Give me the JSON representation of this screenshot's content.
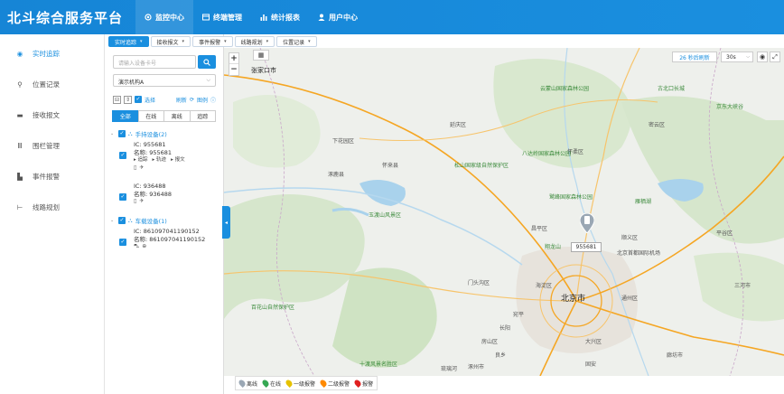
{
  "header": {
    "brand": "北斗综合服务平台",
    "nav": [
      {
        "label": "监控中心",
        "icon": "monitor-icon",
        "active": true
      },
      {
        "label": "终端管理",
        "icon": "terminal-icon",
        "active": false
      },
      {
        "label": "统计报表",
        "icon": "chart-icon",
        "active": false
      },
      {
        "label": "用户中心",
        "icon": "user-icon",
        "active": false
      }
    ]
  },
  "sidebar": {
    "items": [
      {
        "label": "实时追踪",
        "icon": "target-icon",
        "active": true
      },
      {
        "label": "位置记录",
        "icon": "location-icon",
        "active": false
      },
      {
        "label": "接收报文",
        "icon": "message-icon",
        "active": false
      },
      {
        "label": "围栏管理",
        "icon": "fence-icon",
        "active": false
      },
      {
        "label": "事件报警",
        "icon": "alarm-icon",
        "active": false
      },
      {
        "label": "线路规划",
        "icon": "route-icon",
        "active": false
      }
    ]
  },
  "tabs": [
    {
      "label": "实时追踪",
      "active": true
    },
    {
      "label": "接收报文",
      "active": false
    },
    {
      "label": "事件报警",
      "active": false
    },
    {
      "label": "线路规划",
      "active": false
    },
    {
      "label": "位置记录",
      "active": false
    }
  ],
  "panel": {
    "search_placeholder": "请输入设备卡号",
    "org_select": "演示机构A",
    "select_all_label": "选择",
    "refresh_label": "刷新",
    "legend_label": "图例",
    "filters": [
      {
        "label": "全部",
        "active": true
      },
      {
        "label": "在线",
        "active": false
      },
      {
        "label": "离线",
        "active": false
      },
      {
        "label": "追踪",
        "active": false
      }
    ],
    "groups": [
      {
        "name": "手持设备(2)",
        "devices": [
          {
            "ic": "IC: 955681",
            "name": "名称: 955681",
            "links": [
              "追踪",
              "轨迹",
              "报文"
            ]
          },
          {
            "ic": "IC: 936488",
            "name": "名称: 936488",
            "links": []
          }
        ]
      },
      {
        "name": "车载设备(1)",
        "devices": [
          {
            "ic": "IC: 861097041190152",
            "name": "名称: 861097041190152",
            "links": []
          }
        ]
      }
    ]
  },
  "map": {
    "refresh_countdown": "26 秒后刷新",
    "interval": "30s",
    "marker_label": "955681",
    "labels": {
      "zhangjiakou": "张家口市",
      "beijing": "北京市",
      "xiahuayuan": "下花园区",
      "huailai": "怀来县",
      "zhuolu": "涿鹿县",
      "yanqing": "延庆区",
      "huairou": "怀柔区",
      "miyun": "密云区",
      "changping": "昌平区",
      "shunyi": "顺义区",
      "pinggu": "平谷区",
      "haidian": "海淀区",
      "tongzhou": "通州区",
      "daxing": "大兴区",
      "fangshan": "房山区",
      "mentougou": "门头沟区",
      "capital_airport": "北京首都国际机场",
      "badaling": "八达岭国家森林公园",
      "songshan": "松山国家级自然保护区",
      "yunmengshan": "云蒙山国家森林公园",
      "yudushan": "玉渡山风景区",
      "jiufeng": "鹫峰国家森林公园",
      "shidu": "十渡风景名胜区",
      "baihuashan": "百花山自然保护区",
      "yanqi": "雁栖湖",
      "jingdong": "京东大峡谷",
      "sanhe": "三河市",
      "gubeikou": "古北口长城",
      "xianglong": "翔龙山",
      "wanping": "宛平",
      "changyang": "长阳",
      "liangxiang": "良乡",
      "liulihe": "琉璃河",
      "zhuozhou": "涿州市",
      "gu_an": "固安",
      "langfang": "廊坊市"
    },
    "legend": [
      {
        "label": "离线",
        "color": "#9aa7b4"
      },
      {
        "label": "在线",
        "color": "#35a853"
      },
      {
        "label": "一级报警",
        "color": "#e6c200"
      },
      {
        "label": "二级报警",
        "color": "#ff8a00"
      },
      {
        "label": "报警",
        "color": "#e02020"
      }
    ]
  },
  "colors": {
    "primary": "#1a8fdf",
    "header": "#1685d6"
  }
}
